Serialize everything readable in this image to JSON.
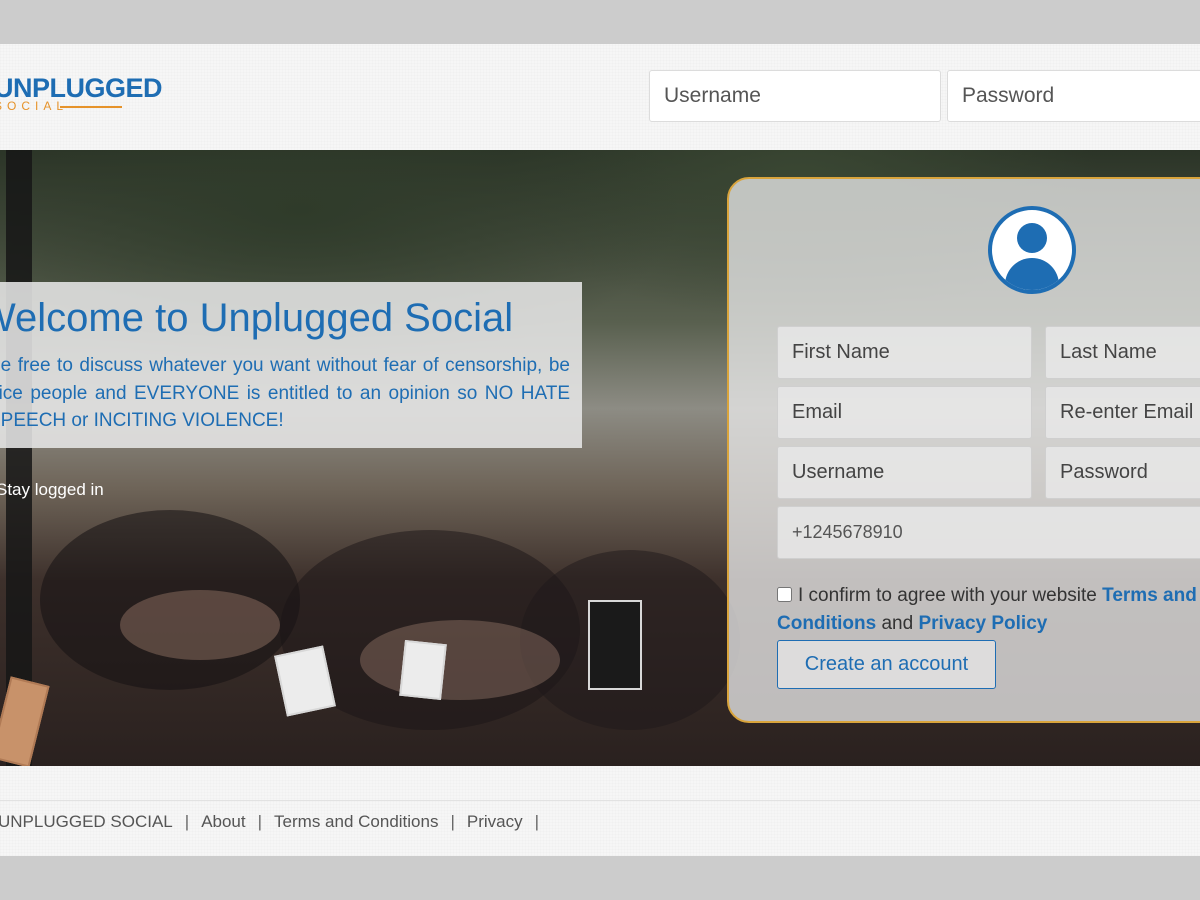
{
  "header": {
    "logo_line1": "UNPLUGGED",
    "logo_line2": "SOCIAL",
    "username_placeholder": "Username",
    "password_placeholder": "Password"
  },
  "hero": {
    "welcome_title": "Welcome to Unplugged Social",
    "welcome_body": "Be free to discuss whatever you want without fear of censorship, be nice people and EVERYONE is entitled to an opinion so NO HATE SPEECH or INCITING VIOLENCE!",
    "logged_in_text": "Stay logged in"
  },
  "register": {
    "avatar_icon": "user-circle-icon",
    "first_name_placeholder": "First Name",
    "last_name_placeholder": "Last Name",
    "email_placeholder": "Email",
    "reenter_email_placeholder": "Re-enter Email",
    "username_placeholder": "Username",
    "password_placeholder": "Password",
    "phone_placeholder": "+1245678910",
    "terms_prefix": "I confirm to agree with your website",
    "terms_link": "Terms and Conditions",
    "terms_and": "and",
    "privacy_link": "Privacy Policy",
    "create_button": "Create an account"
  },
  "footer": {
    "brand": "UNPLUGGED SOCIAL",
    "links": [
      "About",
      "Terms and Conditions",
      "Privacy"
    ],
    "separator": "|"
  },
  "colors": {
    "brand_blue": "#1e6db3",
    "brand_orange": "#e6932a",
    "panel_border": "#d9a43c"
  }
}
